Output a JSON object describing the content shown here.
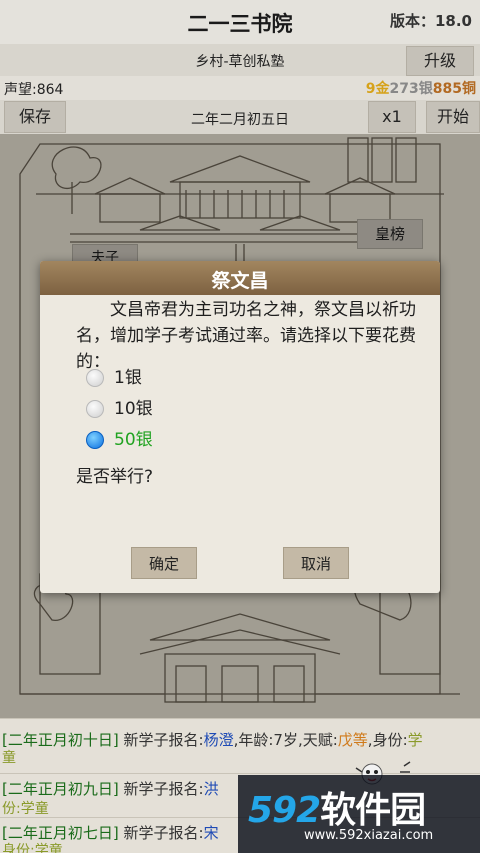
{
  "header": {
    "title": "二一三书院",
    "version": "版本：18.0"
  },
  "school": {
    "name": "乡村-草创私塾",
    "upgrade_label": "升级"
  },
  "status": {
    "reputation": "声望:864",
    "gold": "9金",
    "silver": "273银",
    "copper": "885铜"
  },
  "toolbar": {
    "save_label": "保存",
    "date": "二年二月初五日",
    "speed_label": "x1",
    "start_label": "开始"
  },
  "scene": {
    "ranking_label": "皇榜",
    "master_label": "夫子"
  },
  "dialog": {
    "title": "祭文昌",
    "body": "文昌帝君为主司功名之神，祭文昌以祈功名，增加学子考试通过率。请选择以下要花费的：",
    "options": [
      {
        "label": "1银",
        "checked": false
      },
      {
        "label": "10银",
        "checked": false
      },
      {
        "label": "50银",
        "checked": true
      }
    ],
    "question": "是否举行?",
    "confirm_label": "确定",
    "cancel_label": "取消"
  },
  "log": [
    {
      "date": "[二年正月初十日]",
      "text": "新学子报名:",
      "name": "杨澄",
      "info": ",年龄:7岁,天赋:",
      "grade": "戊等",
      "role_prefix": ",身份:",
      "role": "学",
      "wrap": "童"
    },
    {
      "date": "[二年正月初九日]",
      "text": "新学子报名:",
      "name": "洪",
      "info": "",
      "grade": "",
      "role_prefix": "",
      "role": "",
      "wrap": "份:学童"
    },
    {
      "date": "[二年正月初七日]",
      "text": "新学子报名:",
      "name": "宋",
      "info": "",
      "grade": "",
      "role_prefix": "",
      "role": "",
      "wrap": "身份:学童"
    }
  ],
  "watermark": {
    "logo_num": "592",
    "logo_cn": "软件园",
    "url": "www.592xiazai.com"
  },
  "colors": {
    "dialog_header": "#8b6e4b",
    "selected_option": "#21a321",
    "gold": "#d6a21a",
    "copper": "#b26a23"
  }
}
